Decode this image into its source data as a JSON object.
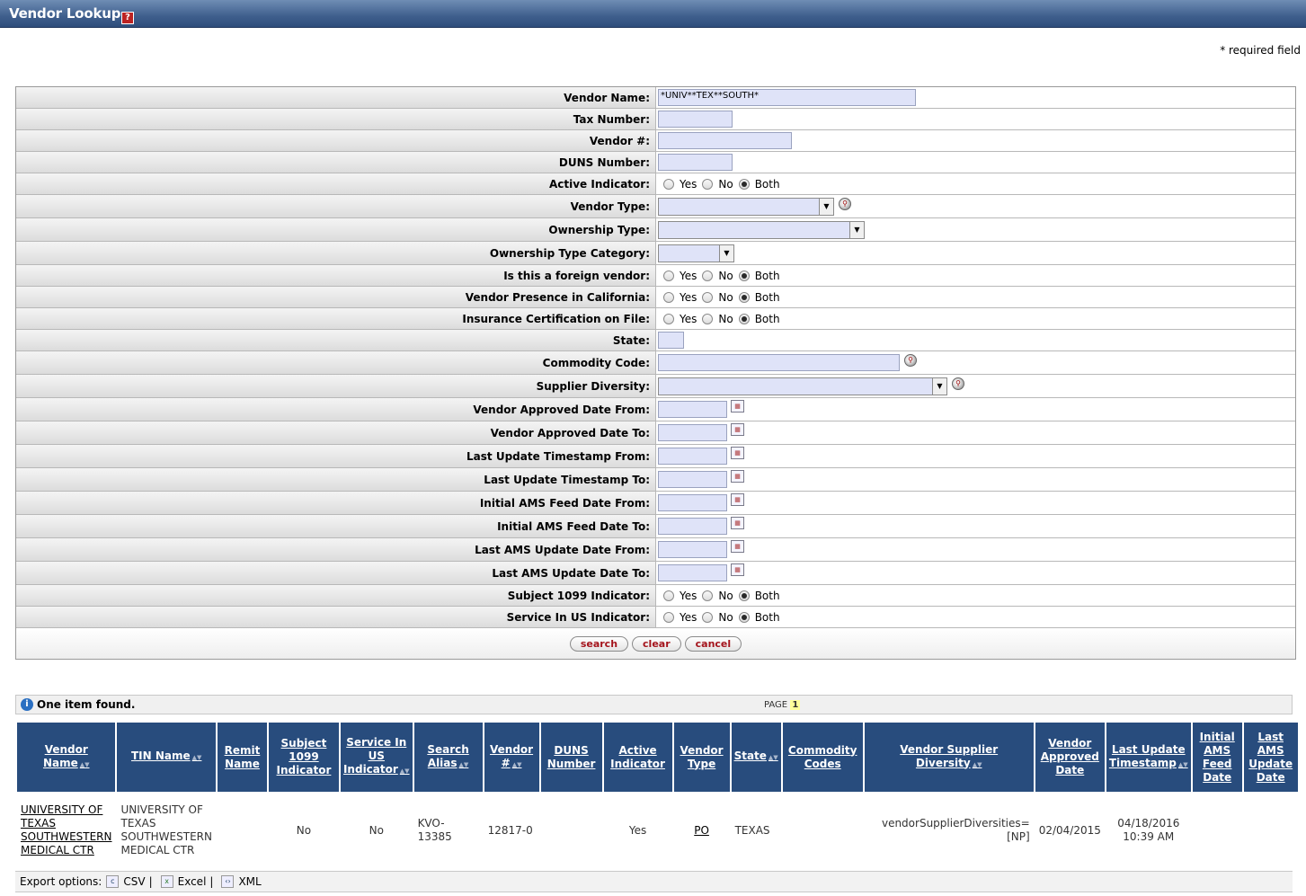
{
  "page": {
    "title": "Vendor Lookup",
    "help_icon": "?",
    "required_note": "* required field"
  },
  "criteria": {
    "vendor_name": {
      "label": "Vendor Name:",
      "value": "*UNIV**TEX**SOUTH*"
    },
    "tax_number": {
      "label": "Tax Number:",
      "value": ""
    },
    "vendor_num": {
      "label": "Vendor #:",
      "value": ""
    },
    "duns_number": {
      "label": "DUNS Number:",
      "value": ""
    },
    "active_indicator": {
      "label": "Active Indicator:",
      "selected": "Both"
    },
    "vendor_type": {
      "label": "Vendor Type:",
      "value": ""
    },
    "ownership_type": {
      "label": "Ownership Type:",
      "value": ""
    },
    "ownership_type_category": {
      "label": "Ownership Type Category:",
      "value": ""
    },
    "foreign_vendor": {
      "label": "Is this a foreign vendor:",
      "selected": "Both"
    },
    "presence_california": {
      "label": "Vendor Presence in California:",
      "selected": "Both"
    },
    "insurance_cert": {
      "label": "Insurance Certification on File:",
      "selected": "Both"
    },
    "state": {
      "label": "State:",
      "value": ""
    },
    "commodity_code": {
      "label": "Commodity Code:",
      "value": ""
    },
    "supplier_diversity": {
      "label": "Supplier Diversity:",
      "value": ""
    },
    "approved_from": {
      "label": "Vendor Approved Date From:",
      "value": ""
    },
    "approved_to": {
      "label": "Vendor Approved Date To:",
      "value": ""
    },
    "last_update_from": {
      "label": "Last Update Timestamp From:",
      "value": ""
    },
    "last_update_to": {
      "label": "Last Update Timestamp To:",
      "value": ""
    },
    "ams_feed_from": {
      "label": "Initial AMS Feed Date From:",
      "value": ""
    },
    "ams_feed_to": {
      "label": "Initial AMS Feed Date To:",
      "value": ""
    },
    "ams_update_from": {
      "label": "Last AMS Update Date From:",
      "value": ""
    },
    "ams_update_to": {
      "label": "Last AMS Update Date To:",
      "value": ""
    },
    "subject_1099": {
      "label": "Subject 1099 Indicator:",
      "selected": "Both"
    },
    "service_in_us": {
      "label": "Service In US Indicator:",
      "selected": "Both"
    },
    "radio_options": {
      "yes": "Yes",
      "no": "No",
      "both": "Both"
    }
  },
  "buttons": {
    "search": "search",
    "clear": "clear",
    "cancel": "cancel"
  },
  "results_info": {
    "found": "One item found.",
    "page_label": "PAGE",
    "page_num": "1"
  },
  "results": {
    "columns": [
      "Vendor Name",
      "TIN Name",
      "Remit Name",
      "Subject 1099 Indicator",
      "Service In US Indicator",
      "Search Alias",
      "Vendor #",
      "DUNS Number",
      "Active Indicator",
      "Vendor Type",
      "State",
      "Commodity Codes",
      "Vendor Supplier Diversity",
      "Vendor Approved Date",
      "Last Update Timestamp",
      "Initial AMS Feed Date",
      "Last AMS Update Date"
    ],
    "rows": [
      {
        "vendor_name": "UNIVERSITY OF TEXAS SOUTHWESTERN MEDICAL CTR",
        "tin_name": "UNIVERSITY OF TEXAS SOUTHWESTERN MEDICAL CTR",
        "remit_name": "",
        "subject_1099": "No",
        "service_in_us": "No",
        "search_alias": "KVO-13385",
        "vendor_num": "12817-0",
        "duns_number": "",
        "active": "Yes",
        "vendor_type": "PO",
        "state": "TEXAS",
        "commodity_codes": "",
        "supplier_diversity": "vendorSupplierDiversities=[NP]",
        "approved_date": "02/04/2015",
        "last_update": "04/18/2016 10:39 AM",
        "ams_feed": "",
        "ams_update": ""
      }
    ]
  },
  "export": {
    "label": "Export options:",
    "csv": "CSV",
    "excel": "Excel",
    "xml": "XML",
    "separator": "|"
  }
}
